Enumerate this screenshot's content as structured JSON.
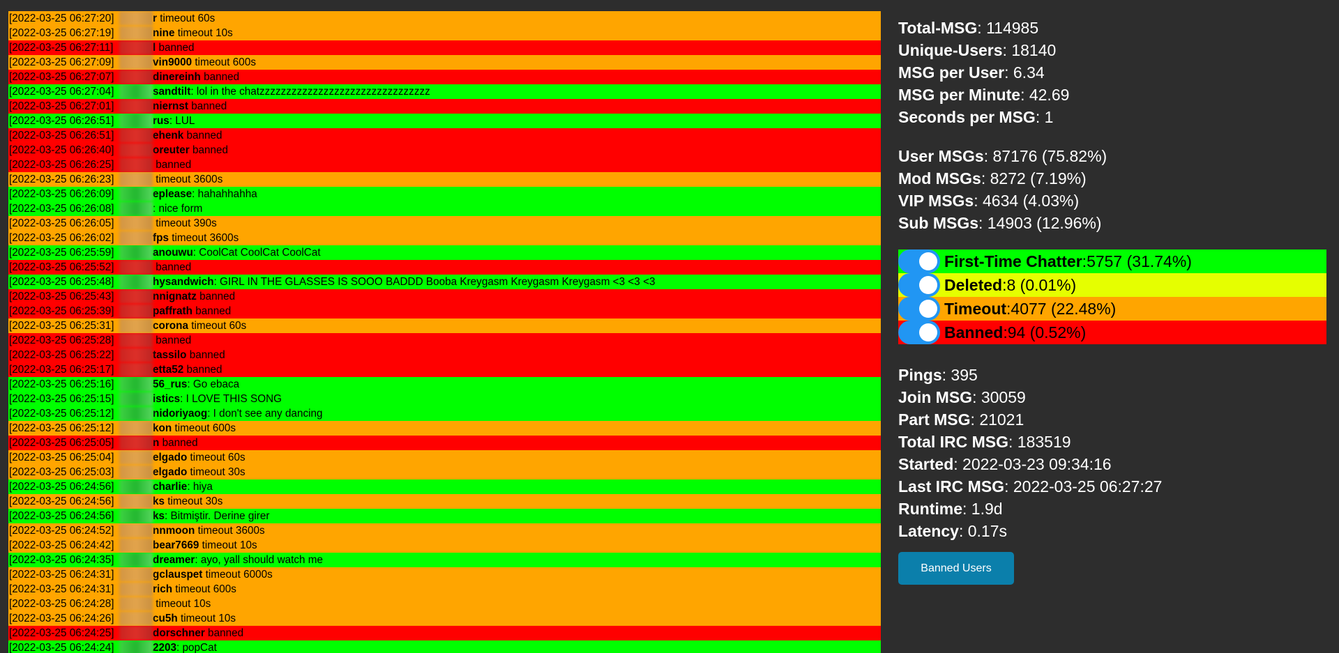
{
  "chat": [
    {
      "ts": "[2022-03-25 06:27:20]",
      "user": "r",
      "text": " timeout 60s",
      "type": "timeout"
    },
    {
      "ts": "[2022-03-25 06:27:19]",
      "user": "nine",
      "text": " timeout 10s",
      "type": "timeout"
    },
    {
      "ts": "[2022-03-25 06:27:11]",
      "user": "l",
      "text": " banned",
      "type": "banned"
    },
    {
      "ts": "[2022-03-25 06:27:09]",
      "user": "vin9000",
      "text": " timeout 600s",
      "type": "timeout"
    },
    {
      "ts": "[2022-03-25 06:27:07]",
      "user": "dinereinh",
      "text": " banned",
      "type": "banned"
    },
    {
      "ts": "[2022-03-25 06:27:04]",
      "user": "sandtilt",
      "text": ": lol in the chatzzzzzzzzzzzzzzzzzzzzzzzzzzzzzzzz",
      "type": "chat"
    },
    {
      "ts": "[2022-03-25 06:27:01]",
      "user": "niernst",
      "text": " banned",
      "type": "banned"
    },
    {
      "ts": "[2022-03-25 06:26:51]",
      "user": "rus",
      "text": ": LUL",
      "type": "chat"
    },
    {
      "ts": "[2022-03-25 06:26:51]",
      "user": "ehenk",
      "text": " banned",
      "type": "banned"
    },
    {
      "ts": "[2022-03-25 06:26:40]",
      "user": "oreuter",
      "text": " banned",
      "type": "banned"
    },
    {
      "ts": "[2022-03-25 06:26:25]",
      "user": "",
      "text": " banned",
      "type": "banned"
    },
    {
      "ts": "[2022-03-25 06:26:23]",
      "user": "",
      "text": " timeout 3600s",
      "type": "timeout"
    },
    {
      "ts": "[2022-03-25 06:26:09]",
      "user": "eplease",
      "text": ": hahahhahha",
      "type": "chat"
    },
    {
      "ts": "[2022-03-25 06:26:08]",
      "user": "",
      "text": ": nice form",
      "type": "chat"
    },
    {
      "ts": "[2022-03-25 06:26:05]",
      "user": "",
      "text": " timeout 390s",
      "type": "timeout"
    },
    {
      "ts": "[2022-03-25 06:26:02]",
      "user": "fps",
      "text": " timeout 3600s",
      "type": "timeout"
    },
    {
      "ts": "[2022-03-25 06:25:59]",
      "user": "anouwu",
      "text": ": CoolCat CoolCat CoolCat",
      "type": "chat"
    },
    {
      "ts": "[2022-03-25 06:25:52]",
      "user": "",
      "text": " banned",
      "type": "banned"
    },
    {
      "ts": "[2022-03-25 06:25:48]",
      "user": "hysandwich",
      "text": ": GIRL IN THE GLASSES IS SOOO BADDD Booba Kreygasm Kreygasm Kreygasm <3 <3 <3",
      "type": "chat"
    },
    {
      "ts": "[2022-03-25 06:25:43]",
      "user": "nnignatz",
      "text": " banned",
      "type": "banned"
    },
    {
      "ts": "[2022-03-25 06:25:39]",
      "user": "paffrath",
      "text": " banned",
      "type": "banned"
    },
    {
      "ts": "[2022-03-25 06:25:31]",
      "user": "corona",
      "text": " timeout 60s",
      "type": "timeout"
    },
    {
      "ts": "[2022-03-25 06:25:28]",
      "user": "",
      "text": " banned",
      "type": "banned"
    },
    {
      "ts": "[2022-03-25 06:25:22]",
      "user": "tassilo",
      "text": " banned",
      "type": "banned"
    },
    {
      "ts": "[2022-03-25 06:25:17]",
      "user": "etta52",
      "text": " banned",
      "type": "banned"
    },
    {
      "ts": "[2022-03-25 06:25:16]",
      "user": "56_rus",
      "text": ": Go ebaca",
      "type": "chat"
    },
    {
      "ts": "[2022-03-25 06:25:15]",
      "user": "istics",
      "text": ": I LOVE THIS SONG",
      "type": "chat"
    },
    {
      "ts": "[2022-03-25 06:25:12]",
      "user": "nidoriyaog",
      "text": ": I don't see any dancing",
      "type": "chat"
    },
    {
      "ts": "[2022-03-25 06:25:12]",
      "user": "kon",
      "text": " timeout 600s",
      "type": "timeout"
    },
    {
      "ts": "[2022-03-25 06:25:05]",
      "user": "n",
      "text": " banned",
      "type": "banned"
    },
    {
      "ts": "[2022-03-25 06:25:04]",
      "user": "elgado",
      "text": " timeout 60s",
      "type": "timeout"
    },
    {
      "ts": "[2022-03-25 06:25:03]",
      "user": "elgado",
      "text": " timeout 30s",
      "type": "timeout"
    },
    {
      "ts": "[2022-03-25 06:24:56]",
      "user": "charlie",
      "text": ": hiya",
      "type": "chat"
    },
    {
      "ts": "[2022-03-25 06:24:56]",
      "user": "ks",
      "text": " timeout 30s",
      "type": "timeout"
    },
    {
      "ts": "[2022-03-25 06:24:56]",
      "user": "ks",
      "text": ": Bitmiştir. Derine girer",
      "type": "chat"
    },
    {
      "ts": "[2022-03-25 06:24:52]",
      "user": "nnmoon",
      "text": " timeout 3600s",
      "type": "timeout"
    },
    {
      "ts": "[2022-03-25 06:24:42]",
      "user": "bear7669",
      "text": " timeout 10s",
      "type": "timeout"
    },
    {
      "ts": "[2022-03-25 06:24:35]",
      "user": "dreamer",
      "text": ": ayo, yall should watch me",
      "type": "chat"
    },
    {
      "ts": "[2022-03-25 06:24:31]",
      "user": "gclauspet",
      "text": " timeout 6000s",
      "type": "timeout"
    },
    {
      "ts": "[2022-03-25 06:24:31]",
      "user": "rich",
      "text": " timeout 600s",
      "type": "timeout"
    },
    {
      "ts": "[2022-03-25 06:24:28]",
      "user": "",
      "text": " timeout 10s",
      "type": "timeout"
    },
    {
      "ts": "[2022-03-25 06:24:26]",
      "user": "cu5h",
      "text": " timeout 10s",
      "type": "timeout"
    },
    {
      "ts": "[2022-03-25 06:24:25]",
      "user": "dorschner",
      "text": " banned",
      "type": "banned"
    },
    {
      "ts": "[2022-03-25 06:24:24]",
      "user": "2203",
      "text": ": popCat",
      "type": "chat"
    }
  ],
  "stats": {
    "totals": [
      {
        "label": "Total-MSG",
        "value": "114985"
      },
      {
        "label": "Unique-Users",
        "value": "18140"
      },
      {
        "label": "MSG per User",
        "value": "6.34"
      },
      {
        "label": "MSG per Minute",
        "value": "42.69"
      },
      {
        "label": "Seconds per MSG",
        "value": "1"
      }
    ],
    "roles": [
      {
        "label": "User MSGs",
        "value": "87176 (75.82%)"
      },
      {
        "label": "Mod MSGs",
        "value": "8272 (7.19%)"
      },
      {
        "label": "VIP MSGs",
        "value": "4634 (4.03%)"
      },
      {
        "label": "Sub MSGs",
        "value": "14903 (12.96%)"
      }
    ],
    "toggles": [
      {
        "label": "First-Time Chatter",
        "value": "5757 (31.74%)",
        "color": "#00ff00",
        "on": true
      },
      {
        "label": "Deleted",
        "value": "8 (0.01%)",
        "color": "#e5ff00",
        "on": true
      },
      {
        "label": "Timeout",
        "value": "4077 (22.48%)",
        "color": "#ffa500",
        "on": true
      },
      {
        "label": "Banned",
        "value": "94 (0.52%)",
        "color": "#ff0000",
        "on": true
      }
    ],
    "irc": [
      {
        "label": "Pings",
        "value": "395"
      },
      {
        "label": "Join MSG",
        "value": "30059"
      },
      {
        "label": "Part MSG",
        "value": "21021"
      },
      {
        "label": "Total IRC MSG",
        "value": "183519"
      },
      {
        "label": "Started",
        "value": "2022-03-23 09:34:16"
      },
      {
        "label": "Last IRC MSG",
        "value": "2022-03-25 06:27:27"
      },
      {
        "label": "Runtime",
        "value": "1.9d"
      },
      {
        "label": "Latency",
        "value": "0.17s"
      }
    ]
  },
  "banned_users_button": "Banned Users",
  "colors": {
    "background": "#2d2d2d",
    "chat": "#00ff00",
    "timeout": "#ffa500",
    "banned": "#ff0000",
    "deleted": "#e5ff00",
    "toggle_on": "#2196f3",
    "button": "#0b7fab"
  }
}
